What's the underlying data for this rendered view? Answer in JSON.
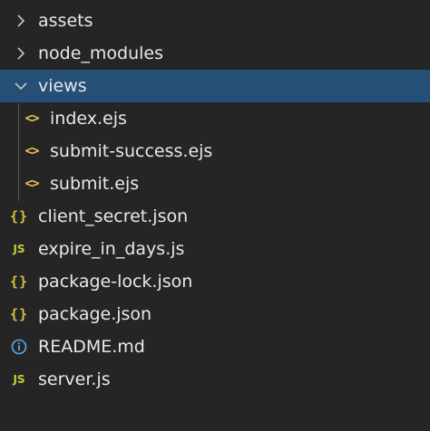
{
  "explorer": {
    "folders": {
      "assets": "assets",
      "node_modules": "node_modules",
      "views": "views"
    },
    "view_files": [
      {
        "name": "index.ejs",
        "icon": "ejs-icon"
      },
      {
        "name": "submit-success.ejs",
        "icon": "ejs-icon"
      },
      {
        "name": "submit.ejs",
        "icon": "ejs-icon"
      }
    ],
    "root_files": [
      {
        "name": "client_secret.json",
        "icon": "json-icon"
      },
      {
        "name": "expire_in_days.js",
        "icon": "js-icon"
      },
      {
        "name": "package-lock.json",
        "icon": "json-icon"
      },
      {
        "name": "package.json",
        "icon": "json-icon"
      },
      {
        "name": "README.md",
        "icon": "info-icon"
      },
      {
        "name": "server.js",
        "icon": "js-icon"
      }
    ],
    "icon_glyphs": {
      "ejs": "<>",
      "json": "{}",
      "js": "JS"
    },
    "colors": {
      "background": "#252526",
      "selected": "#264f78",
      "text": "#e8e8e8",
      "ejs_icon": "#e6c84a",
      "json_icon": "#d9c240",
      "js_icon": "#cbcb41",
      "info_icon": "#5fa8e0"
    }
  }
}
